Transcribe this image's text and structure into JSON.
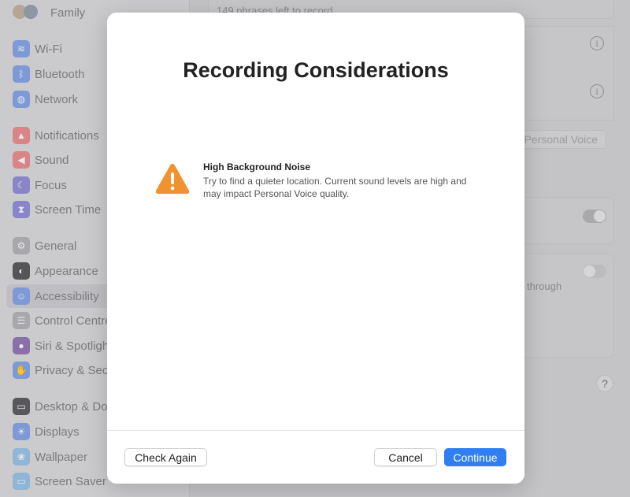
{
  "sidebar": {
    "account": "Family",
    "items": [
      {
        "label": "Wi-Fi",
        "icon": "wifi-icon",
        "color": "#7d9ad6",
        "glyph": "≋"
      },
      {
        "label": "Bluetooth",
        "icon": "bluetooth-icon",
        "color": "#7d9ad6",
        "glyph": "ᛒ"
      },
      {
        "label": "Network",
        "icon": "globe-icon",
        "color": "#7d9ad6",
        "glyph": "◍"
      },
      {
        "label": "Notifications",
        "icon": "bell-icon",
        "color": "#d98585",
        "glyph": "▲"
      },
      {
        "label": "Sound",
        "icon": "speaker-icon",
        "color": "#d98585",
        "glyph": "◀"
      },
      {
        "label": "Focus",
        "icon": "moon-icon",
        "color": "#8a85c9",
        "glyph": "☾"
      },
      {
        "label": "Screen Time",
        "icon": "hourglass-icon",
        "color": "#8a85c9",
        "glyph": "⧗"
      },
      {
        "label": "General",
        "icon": "gear-icon",
        "color": "#a8a8ac",
        "glyph": "⚙"
      },
      {
        "label": "Appearance",
        "icon": "appearance-icon",
        "color": "#555558",
        "glyph": "◐"
      },
      {
        "label": "Accessibility",
        "icon": "accessibility-icon",
        "color": "#7d9ad6",
        "glyph": "☺"
      },
      {
        "label": "Control Centre",
        "icon": "control-centre-icon",
        "color": "#a8a8ac",
        "glyph": "☰"
      },
      {
        "label": "Siri & Spotlight",
        "icon": "siri-icon",
        "color": "#8a6fa8",
        "glyph": "●"
      },
      {
        "label": "Privacy & Security",
        "icon": "hand-icon",
        "color": "#7d9ad6",
        "glyph": "✋"
      },
      {
        "label": "Desktop & Dock",
        "icon": "desktop-icon",
        "color": "#58585c",
        "glyph": "▭"
      },
      {
        "label": "Displays",
        "icon": "sun-icon",
        "color": "#7d9ad6",
        "glyph": "☀"
      },
      {
        "label": "Wallpaper",
        "icon": "wallpaper-icon",
        "color": "#8fb6d6",
        "glyph": "❀"
      },
      {
        "label": "Screen Saver",
        "icon": "screensaver-icon",
        "color": "#8fb6d6",
        "glyph": "▭"
      }
    ],
    "selected": "Accessibility"
  },
  "main": {
    "phrases": "149 phrases left to record",
    "personal_voice_button": "Personal Voice",
    "through_text": "through",
    "help": "?"
  },
  "dialog": {
    "title": "Recording Considerations",
    "warning_title": "High Background Noise",
    "warning_text": "Try to find a quieter location. Current sound levels are high and may impact Personal Voice quality.",
    "check_again": "Check Again",
    "cancel": "Cancel",
    "continue": "Continue",
    "warning_color": "#f0922f",
    "accent": "#2f7ff2"
  }
}
